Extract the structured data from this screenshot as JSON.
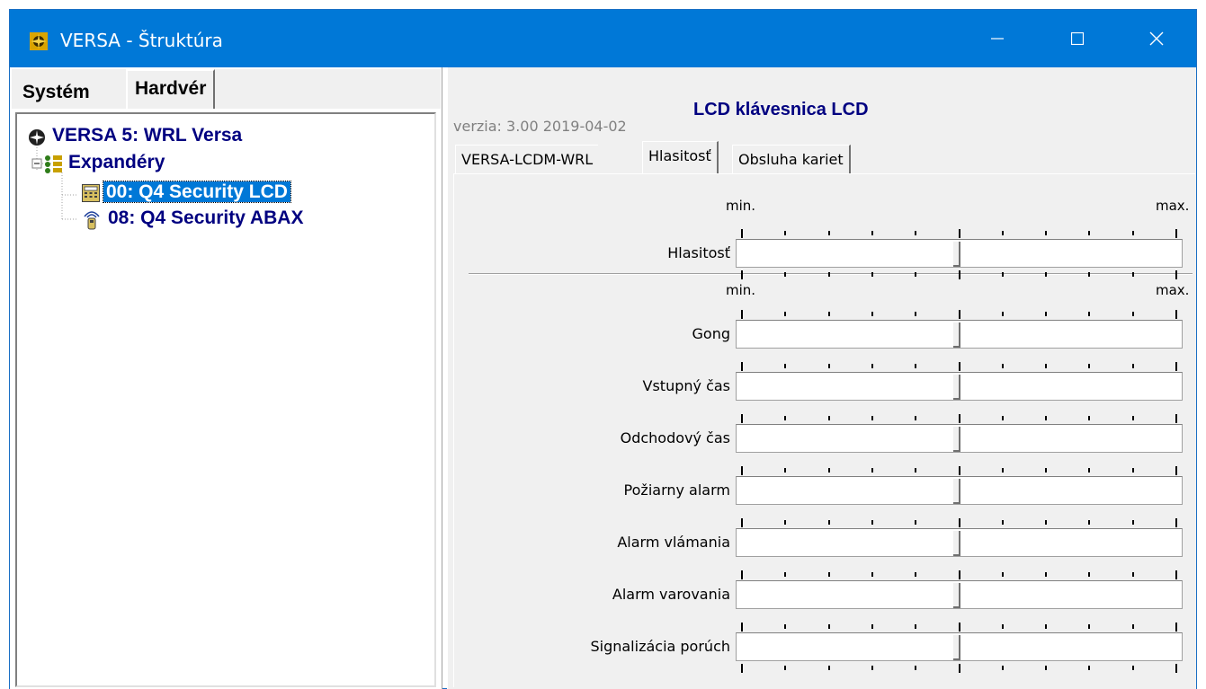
{
  "window": {
    "title": "VERSA - Štruktúra",
    "accent_color": "#0078d7",
    "icons": [
      "app-icon",
      "minimize-icon",
      "maximize-icon",
      "close-icon"
    ]
  },
  "left": {
    "tabs": [
      "Systém",
      "Hardvér"
    ],
    "active_tab": "Hardvér",
    "tree": {
      "root": "VERSA  5: WRL Versa",
      "group": "Expandéry",
      "items": [
        "00: Q4 Security LCD",
        "08: Q4 Security ABAX"
      ],
      "selected": "00: Q4 Security LCD"
    }
  },
  "right": {
    "title": "LCD klávesnica LCD",
    "version": "verzia: 3.00 2019-04-02",
    "tabs": [
      "VERSA-LCDM-WRL",
      "Hlasitosť",
      "Obsluha kariet"
    ],
    "active_tab": "Hlasitosť",
    "min_label": "min.",
    "max_label": "max.",
    "volume_section": {
      "sliders": [
        {
          "label": "Hlasitosť",
          "level": 0.5
        }
      ]
    },
    "sound_section": {
      "sliders": [
        {
          "label": "Gong",
          "level": 0.5
        },
        {
          "label": "Vstupný čas",
          "level": 0.5
        },
        {
          "label": "Odchodový čas",
          "level": 0.5
        },
        {
          "label": "Požiarny alarm",
          "level": 0.5
        },
        {
          "label": "Alarm vlámania",
          "level": 0.5
        },
        {
          "label": "Alarm varovania",
          "level": 0.5
        },
        {
          "label": "Signalizácia porúch",
          "level": 0.5
        }
      ]
    }
  }
}
